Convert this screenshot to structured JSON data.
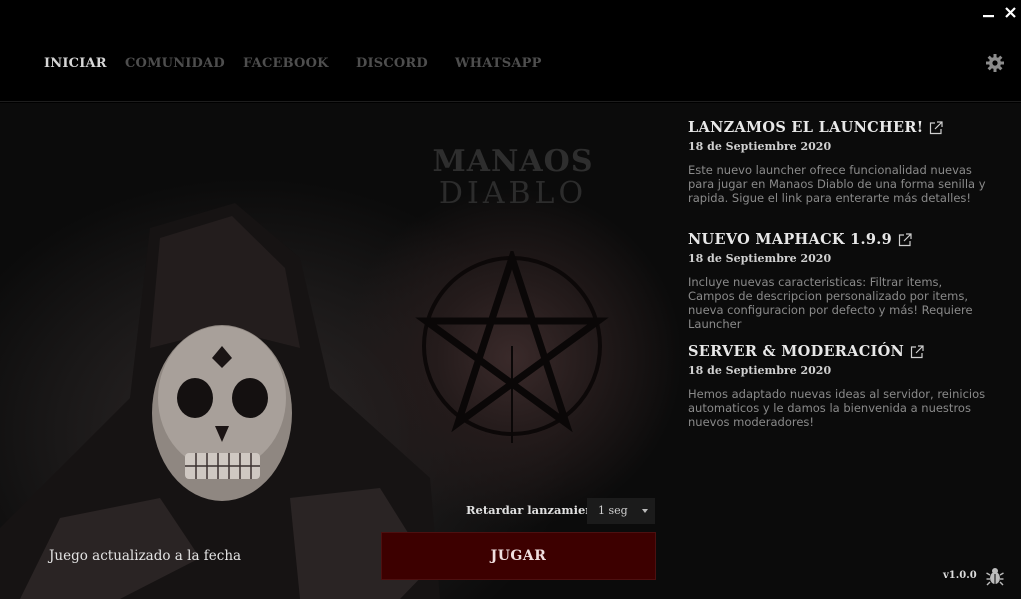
{
  "window": {
    "minimize_glyph": "–",
    "close_glyph": "✕"
  },
  "nav": {
    "items": [
      {
        "label": "INICIAR",
        "active": true
      },
      {
        "label": "COMUNIDAD",
        "active": false
      },
      {
        "label": "FACEBOOK",
        "active": false
      },
      {
        "label": "DISCORD",
        "active": false
      },
      {
        "label": "WHATSAPP",
        "active": false
      }
    ]
  },
  "branding": {
    "logo_line1": "MANAOS",
    "logo_line2": "DIABLO"
  },
  "news": [
    {
      "title": "LANZAMOS EL LAUNCHER!",
      "date": "18 de Septiembre 2020",
      "body": "Este nuevo launcher ofrece funcionalidad nuevas para jugar en Manaos Diablo de una forma senilla y rapida. Sigue el link para enterarte más detalles!"
    },
    {
      "title": "NUEVO MAPHACK 1.9.9",
      "date": "18 de Septiembre 2020",
      "body": "Incluye nuevas caracteristicas: Filtrar items, Campos de descripcion personalizado por items, nueva configuracion por defecto y más! Requiere Launcher"
    },
    {
      "title": "SERVER & MODERACIÓN",
      "date": "18 de Septiembre 2020",
      "body": "Hemos adaptado nuevas ideas al servidor, reinicios automaticos y le damos la bienvenida a nuestros nuevos moderadores!"
    }
  ],
  "launch": {
    "delay_label": "Retardar lanzamiento",
    "delay_value": "1 seg",
    "status": "Juego actualizado a la fecha",
    "play_label": "JUGAR"
  },
  "version": "v1.0.0",
  "colors": {
    "accent": "#3d0000",
    "background": "#000000"
  }
}
